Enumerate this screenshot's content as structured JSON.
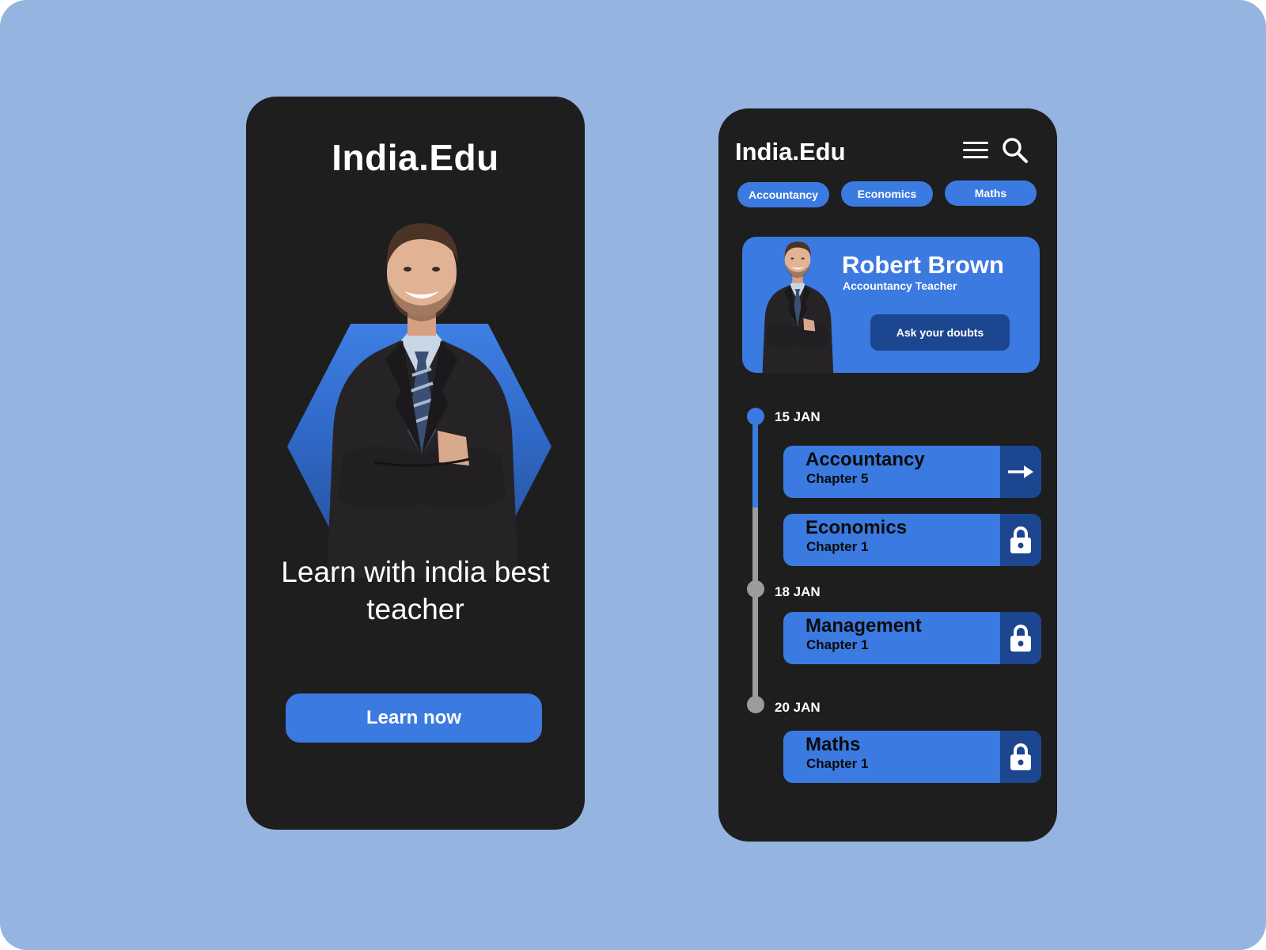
{
  "welcome_screen": {
    "brand": "India.Edu",
    "tagline": "Learn with india best teacher",
    "cta_label": "Learn now"
  },
  "dashboard": {
    "brand": "India.Edu",
    "icons": {
      "menu": "hamburger-icon",
      "search": "search-icon"
    },
    "chips": [
      {
        "label": "Accountancy"
      },
      {
        "label": "Economics"
      },
      {
        "label": "Maths"
      }
    ],
    "teacher": {
      "name": "Robert Brown",
      "role": "Accountancy Teacher",
      "button_label": "Ask your doubts"
    },
    "timeline": {
      "dates": [
        "15 JAN",
        "18 JAN",
        "20 JAN"
      ],
      "lessons": [
        {
          "subject": "Accountancy",
          "chapter": "Chapter 5",
          "action": "arrow-right-icon"
        },
        {
          "subject": "Economics",
          "chapter": "Chapter 1",
          "action": "lock-icon"
        },
        {
          "subject": "Management",
          "chapter": "Chapter 1",
          "action": "lock-icon"
        },
        {
          "subject": "Maths",
          "chapter": "Chapter 1",
          "action": "lock-icon"
        }
      ]
    }
  },
  "colors": {
    "background": "#95b4e0",
    "phone": "#1e1e1e",
    "accent": "#3b7ae0",
    "accent_dark": "#1d4690",
    "timeline_inactive": "#9c9c9c"
  }
}
